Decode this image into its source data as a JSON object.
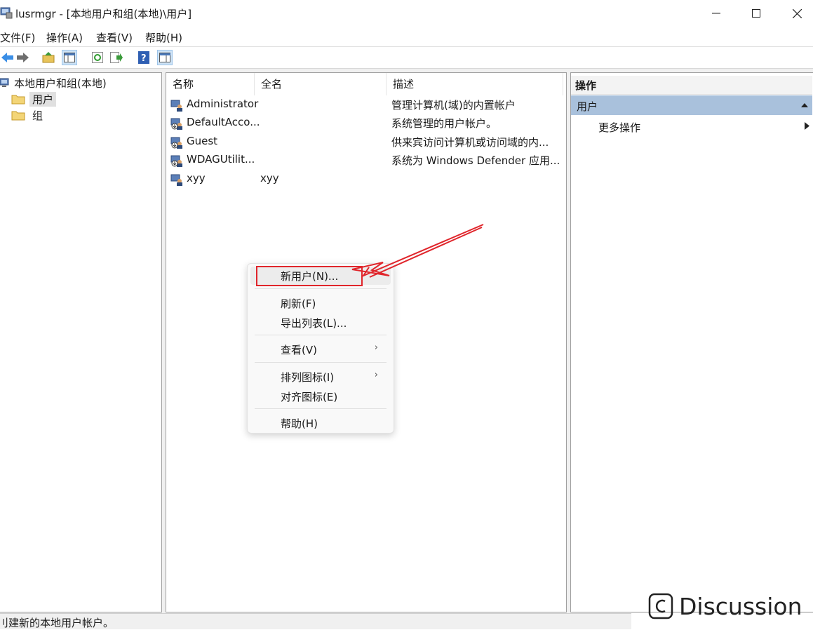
{
  "window": {
    "title": "lusrmgr - [本地用户和组(本地)\\用户]",
    "app_icon": "computer-management-icon",
    "controls": [
      "minimize-icon",
      "maximize-icon",
      "close-icon"
    ]
  },
  "menu": {
    "items": [
      {
        "label": "文件(F)"
      },
      {
        "label": "操作(A)"
      },
      {
        "label": "查看(V)"
      },
      {
        "label": "帮助(H)"
      }
    ]
  },
  "toolbar": {
    "buttons": [
      "back-arrow-icon",
      "forward-arrow-icon",
      "up-folder-icon",
      "show-hide-tree-icon",
      "refresh-icon",
      "export-list-icon",
      "help-icon",
      "show-hide-action-pane-icon"
    ]
  },
  "tree": {
    "root": "本地用户和组(本地)",
    "children": [
      {
        "label": "用户",
        "selected": true
      },
      {
        "label": "组",
        "selected": false
      }
    ]
  },
  "list": {
    "columns": [
      "名称",
      "全名",
      "描述"
    ],
    "rows": [
      {
        "name": "Administrator",
        "fullname": "",
        "description": "管理计算机(域)的内置帐户",
        "disabled": false
      },
      {
        "name": "DefaultAcco...",
        "fullname": "",
        "description": "系统管理的用户帐户。",
        "disabled": true
      },
      {
        "name": "Guest",
        "fullname": "",
        "description": "供来宾访问计算机或访问域的内...",
        "disabled": true
      },
      {
        "name": "WDAGUtilit...",
        "fullname": "",
        "description": "系统为 Windows Defender 应用...",
        "disabled": true
      },
      {
        "name": "xyy",
        "fullname": "xyy",
        "description": "",
        "disabled": false
      }
    ]
  },
  "actions": {
    "header": "操作",
    "section": "用户",
    "more": "更多操作"
  },
  "context_menu": {
    "items": [
      {
        "label": "新用户(N)...",
        "highlighted": true,
        "submenu": false
      },
      {
        "label": "刷新(F)",
        "submenu": false
      },
      {
        "label": "导出列表(L)...",
        "submenu": false
      },
      {
        "label": "查看(V)",
        "submenu": true
      },
      {
        "label": "排列图标(I)",
        "submenu": true
      },
      {
        "label": "对齐图标(E)",
        "submenu": false
      },
      {
        "label": "帮助(H)",
        "submenu": false
      }
    ]
  },
  "status": {
    "text": "刂建新的本地用户帐户。"
  },
  "watermark": {
    "text": "Discussion"
  },
  "colors": {
    "annotation_red": "#e0252b",
    "selection_blue": "#a9c1dc",
    "tree_selected": "#e0e0e0"
  }
}
